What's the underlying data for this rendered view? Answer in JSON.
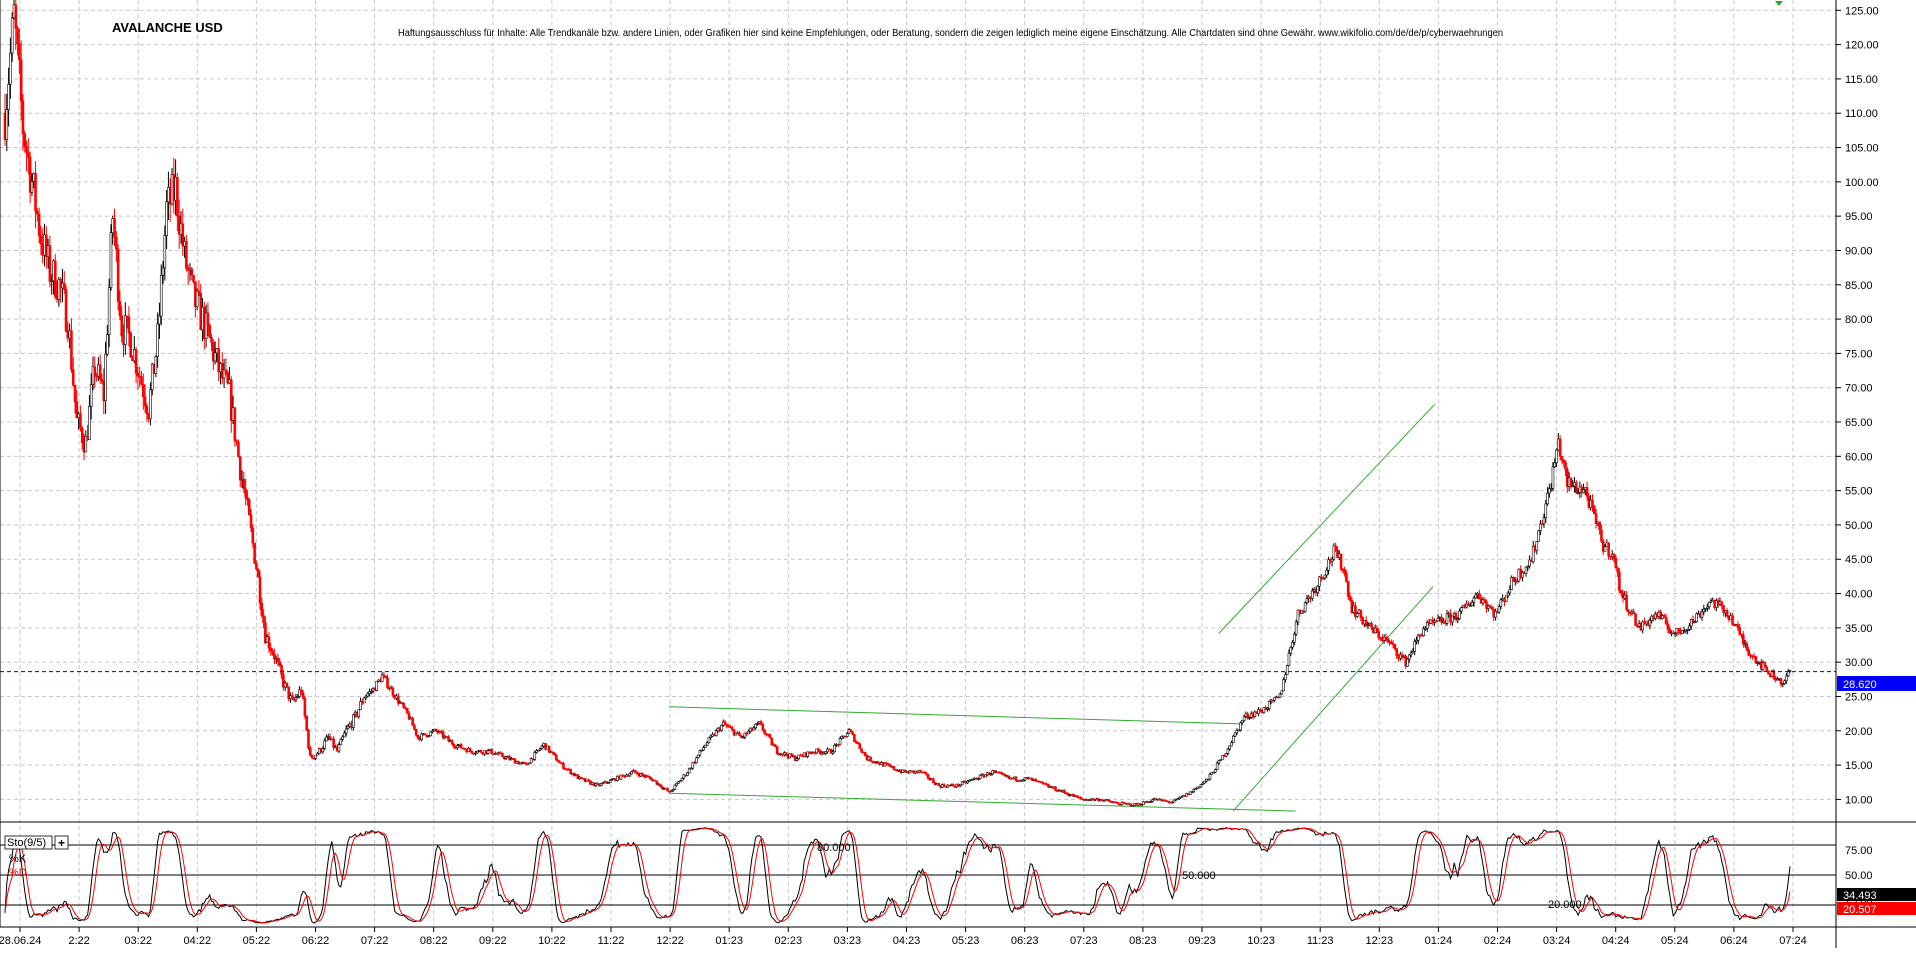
{
  "chart_data": {
    "type": "candlestick",
    "title": "AVALANCHE USD",
    "disclaimer": "Haftungsausschluss für Inhalte: Alle Trendkanäle bzw. andere Linien, oder Grafiken hier sind keine Empfehlungen, oder Beratung, sondern die zeigen lediglich meine eigene Einschätzung. Alle Chartdaten sind ohne Gewähr.  www.wikifolio.com/de/de/p/cyberwaehrungen",
    "y_ticks": [
      "125.00",
      "120.00",
      "115.00",
      "110.00",
      "105.00",
      "100.00",
      "95.00",
      "90.00",
      "85.00",
      "80.00",
      "75.00",
      "70.00",
      "65.00",
      "60.00",
      "55.00",
      "50.00",
      "45.00",
      "40.00",
      "35.00",
      "30.00",
      "25.00",
      "20.00",
      "15.00",
      "10.00"
    ],
    "ylim": [
      7.0,
      126.5
    ],
    "x_ticks": [
      "28.06.24",
      "2:22",
      "03:22",
      "04:22",
      "05:22",
      "06:22",
      "07:22",
      "08:22",
      "09:22",
      "10:22",
      "11:22",
      "12:22",
      "01:23",
      "02:23",
      "03:23",
      "04:23",
      "05:23",
      "06:23",
      "07:23",
      "08:23",
      "09:23",
      "10:23",
      "11:23",
      "12:23",
      "01:24",
      "02:24",
      "03:24",
      "04:24",
      "05:24",
      "06:24",
      "07:24"
    ],
    "current_price": "28.620",
    "current_price_value": 28.62,
    "colors": {
      "up": "#000000",
      "down": "#ff0000",
      "trend": "#33aa33",
      "price_line": "#0000cc",
      "price_label_bg": "#0000ff",
      "k_line": "#000000",
      "d_line": "#ff0000"
    },
    "series": [
      {
        "name": "AVALANCHE USD",
        "anchors": [
          [
            0,
            110
          ],
          [
            5,
            124
          ],
          [
            10,
            108
          ],
          [
            15,
            100
          ],
          [
            20,
            92
          ],
          [
            25,
            87
          ],
          [
            30,
            85
          ],
          [
            35,
            80
          ],
          [
            40,
            65
          ],
          [
            45,
            62
          ],
          [
            50,
            73
          ],
          [
            55,
            69
          ],
          [
            60,
            95
          ],
          [
            65,
            79
          ],
          [
            70,
            77
          ],
          [
            75,
            72
          ],
          [
            80,
            67
          ],
          [
            85,
            77
          ],
          [
            90,
            96
          ],
          [
            95,
            99
          ],
          [
            100,
            89
          ],
          [
            105,
            83
          ],
          [
            110,
            80
          ],
          [
            115,
            76
          ],
          [
            120,
            72
          ],
          [
            125,
            69
          ],
          [
            130,
            60
          ],
          [
            135,
            52
          ],
          [
            140,
            44
          ],
          [
            145,
            34
          ],
          [
            150,
            31
          ],
          [
            155,
            27
          ],
          [
            160,
            24
          ],
          [
            165,
            26
          ],
          [
            170,
            16
          ],
          [
            175,
            17
          ],
          [
            180,
            19
          ],
          [
            185,
            17
          ],
          [
            190,
            20
          ],
          [
            195,
            22
          ],
          [
            200,
            25
          ],
          [
            205,
            26
          ],
          [
            210,
            28
          ],
          [
            215,
            26
          ],
          [
            220,
            24
          ],
          [
            225,
            22
          ],
          [
            230,
            19
          ],
          [
            240,
            20
          ],
          [
            250,
            18
          ],
          [
            260,
            17
          ],
          [
            270,
            17
          ],
          [
            280,
            16
          ],
          [
            290,
            15
          ],
          [
            300,
            18
          ],
          [
            310,
            15
          ],
          [
            320,
            13
          ],
          [
            330,
            12
          ],
          [
            340,
            13
          ],
          [
            350,
            14
          ],
          [
            360,
            13
          ],
          [
            370,
            11
          ],
          [
            380,
            14
          ],
          [
            390,
            18
          ],
          [
            400,
            21
          ],
          [
            410,
            19
          ],
          [
            420,
            21
          ],
          [
            430,
            17
          ],
          [
            440,
            16
          ],
          [
            450,
            17
          ],
          [
            460,
            17
          ],
          [
            470,
            20
          ],
          [
            475,
            18
          ],
          [
            480,
            16
          ],
          [
            490,
            15
          ],
          [
            500,
            14
          ],
          [
            510,
            14
          ],
          [
            520,
            12
          ],
          [
            530,
            12
          ],
          [
            540,
            13
          ],
          [
            550,
            14
          ],
          [
            560,
            13
          ],
          [
            570,
            13
          ],
          [
            580,
            12
          ],
          [
            590,
            11
          ],
          [
            600,
            10
          ],
          [
            610,
            10
          ],
          [
            620,
            9.4
          ],
          [
            630,
            9.2
          ],
          [
            640,
            10
          ],
          [
            650,
            9.6
          ],
          [
            660,
            11
          ],
          [
            670,
            13
          ],
          [
            680,
            17
          ],
          [
            690,
            22
          ],
          [
            700,
            23
          ],
          [
            710,
            25
          ],
          [
            720,
            37
          ],
          [
            730,
            41
          ],
          [
            740,
            46
          ],
          [
            745,
            44
          ],
          [
            750,
            38
          ],
          [
            760,
            35
          ],
          [
            770,
            33
          ],
          [
            780,
            30
          ],
          [
            790,
            35
          ],
          [
            800,
            36
          ],
          [
            810,
            37
          ],
          [
            820,
            40
          ],
          [
            830,
            37
          ],
          [
            840,
            42
          ],
          [
            850,
            45
          ],
          [
            860,
            55
          ],
          [
            865,
            62
          ],
          [
            870,
            56
          ],
          [
            880,
            55
          ],
          [
            890,
            47
          ],
          [
            895,
            46
          ],
          [
            900,
            40
          ],
          [
            910,
            35
          ],
          [
            920,
            37
          ],
          [
            930,
            34
          ],
          [
            940,
            36
          ],
          [
            950,
            39
          ],
          [
            960,
            37
          ],
          [
            970,
            32
          ],
          [
            980,
            29
          ],
          [
            990,
            27
          ],
          [
            994,
            28.6
          ]
        ],
        "n_candles": 995,
        "seed": 7
      }
    ],
    "trendlines": [
      {
        "from": [
          0.0,
          23.5
        ],
        "to": [
          0.345,
          21.0
        ]
      },
      {
        "from": [
          0.0,
          10.9
        ],
        "to": [
          0.376,
          8.3
        ]
      },
      {
        "from": [
          0.333,
          34.2
        ],
        "to": [
          0.801,
          67.6
        ]
      },
      {
        "from": [
          0.341,
          8.3
        ],
        "to": [
          0.8,
          41.0
        ]
      }
    ],
    "oscillator": {
      "name": "Sto(9/5)",
      "k_label": "%K",
      "d_label": "%D",
      "levels": [
        "80.000",
        "50.000",
        "20.000"
      ],
      "level_values": [
        80,
        50,
        20
      ],
      "y_ticks": [
        "75.00",
        "50.00",
        "25.00"
      ],
      "k_value": "34.493",
      "d_value": "20.507",
      "ylim": [
        0,
        100
      ]
    }
  }
}
